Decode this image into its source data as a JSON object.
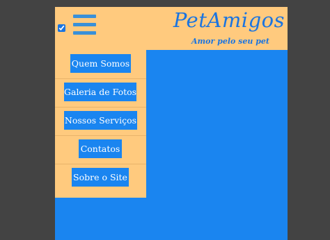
{
  "header": {
    "brand": "PetAmigos",
    "tagline": "Amor pelo seu pet",
    "menu_toggle_checked": true,
    "menu_icon": "hamburger-menu-icon"
  },
  "menu": {
    "items": [
      {
        "label": "Quem Somos"
      },
      {
        "label": "Galeria de Fotos"
      },
      {
        "label": "Nossos Serviços"
      },
      {
        "label": "Contatos"
      },
      {
        "label": "Sobre o Site"
      }
    ]
  },
  "colors": {
    "background": "#434343",
    "header": "#ffca7e",
    "accent": "#1a85f0",
    "brand_text": "#1a74e0",
    "button_text": "#ffffff"
  }
}
